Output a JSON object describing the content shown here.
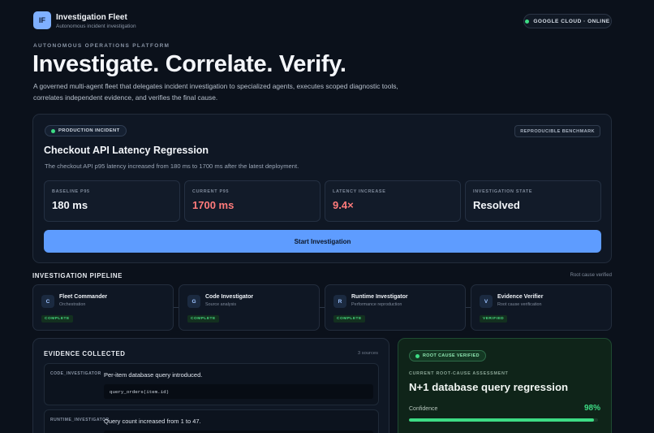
{
  "header": {
    "logo_text": "IF",
    "app_title": "Investigation Fleet",
    "app_subtitle": "Autonomous incident investigation",
    "status": "GOOGLE CLOUD · ONLINE",
    "status_color": "#3ddc84"
  },
  "hero": {
    "eyebrow": "AUTONOMOUS OPERATIONS PLATFORM",
    "title": "Investigate. Correlate. Verify.",
    "description": "A governed multi-agent fleet that delegates incident investigation to specialized agents, executes scoped diagnostic tools, correlates independent evidence, and verifies the final cause."
  },
  "incident": {
    "badge": "PRODUCTION INCIDENT",
    "benchmark": "REPRODUCIBLE BENCHMARK",
    "title": "Checkout API Latency Regression",
    "description": "The checkout API p95 latency increased from 180 ms to 1700 ms after the latest deployment.",
    "metrics": [
      {
        "label": "BASELINE P95",
        "value": "180 ms"
      },
      {
        "label": "CURRENT P95",
        "value": "1700 ms"
      },
      {
        "label": "LATENCY INCREASE",
        "value": "9.4×"
      },
      {
        "label": "INVESTIGATION STATE",
        "value": "Resolved"
      }
    ],
    "start_button": "Start Investigation",
    "accent_color": "#5e9cff"
  },
  "pipeline": {
    "title": "INVESTIGATION PIPELINE",
    "status": "Root cause verified",
    "stages": [
      {
        "icon": "C",
        "name": "Fleet Commander",
        "role": "Orchestration",
        "status": "COMPLETE"
      },
      {
        "icon": "G",
        "name": "Code Investigator",
        "role": "Source analysis",
        "status": "COMPLETE"
      },
      {
        "icon": "R",
        "name": "Runtime Investigator",
        "role": "Performance reproduction",
        "status": "COMPLETE"
      },
      {
        "icon": "V",
        "name": "Evidence Verifier",
        "role": "Root cause verification",
        "status": "VERIFIED"
      }
    ]
  },
  "evidence": {
    "title": "EVIDENCE COLLECTED",
    "count": "3 sources",
    "items": [
      {
        "source": "CODE_INVESTIGATOR",
        "text": "Per-item database query introduced.",
        "code": "query_orders(item.id)"
      },
      {
        "source": "RUNTIME_INVESTIGATOR",
        "text": "Query count increased from 1 to 47.",
        "code": ""
      }
    ]
  },
  "root_cause": {
    "badge": "ROOT CAUSE VERIFIED",
    "label": "CURRENT ROOT-CAUSE ASSESSMENT",
    "title": "N+1 database query regression",
    "confidence_label": "Confidence",
    "confidence": "98%",
    "confidence_fraction": 0.98
  }
}
